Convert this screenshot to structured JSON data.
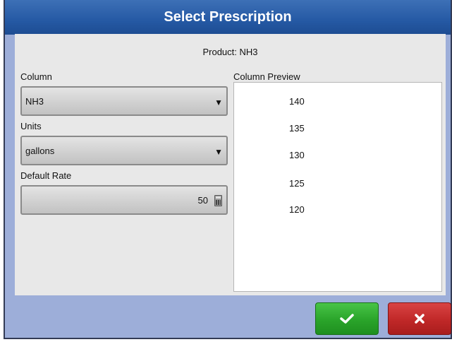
{
  "dialog": {
    "title": "Select Prescription"
  },
  "product": {
    "label": "Product: NH3"
  },
  "column": {
    "label": "Column",
    "value": "NH3",
    "arrow": "▼"
  },
  "units": {
    "label": "Units",
    "value": "gallons",
    "arrow": "▼"
  },
  "default_rate": {
    "label": "Default Rate",
    "value": "50"
  },
  "preview": {
    "label": "Column Preview",
    "items": [
      "140",
      "135",
      "130",
      "125",
      "120"
    ]
  },
  "buttons": {
    "ok_icon": "check-icon",
    "cancel_icon": "close-icon"
  },
  "colors": {
    "title_bar": "#2559a4",
    "ok_button": "#2aa42a",
    "cancel_button": "#c02828",
    "dialog_frame": "#9daed9"
  }
}
